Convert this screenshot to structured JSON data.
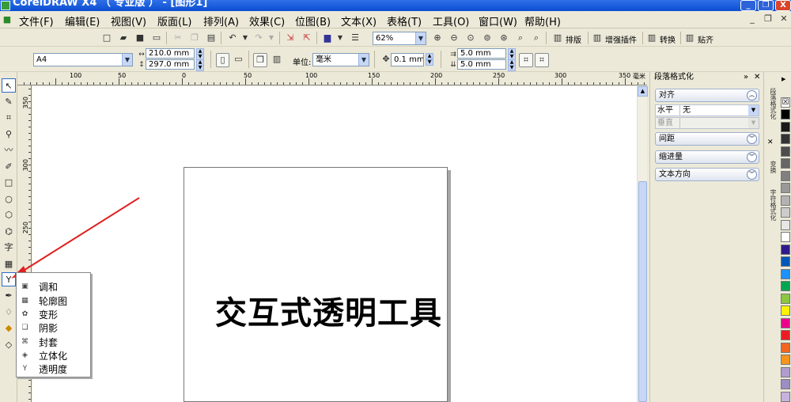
{
  "window": {
    "title": "CorelDRAW X4 （ 专业版 ） - [图形1]",
    "minimize": "_",
    "restore": "❐",
    "close": "X"
  },
  "menu": [
    {
      "key": "file",
      "label": "文件(F)"
    },
    {
      "key": "edit",
      "label": "编辑(E)"
    },
    {
      "key": "view",
      "label": "视图(V)"
    },
    {
      "key": "layout",
      "label": "版面(L)"
    },
    {
      "key": "arrange",
      "label": "排列(A)"
    },
    {
      "key": "effects",
      "label": "效果(C)"
    },
    {
      "key": "bitmaps",
      "label": "位图(B)"
    },
    {
      "key": "text",
      "label": "文本(X)"
    },
    {
      "key": "table",
      "label": "表格(T)"
    },
    {
      "key": "tools",
      "label": "工具(O)"
    },
    {
      "key": "window",
      "label": "窗口(W)"
    },
    {
      "key": "help",
      "label": "帮助(H)"
    }
  ],
  "toolbar": {
    "zoom_value": "62%",
    "snap_label": "排版",
    "plugin_label": "增强插件",
    "convert_label": "转换",
    "paste_label": "贴齐"
  },
  "property_bar": {
    "page_size": "A4",
    "width": "210.0 mm",
    "height": "297.0 mm",
    "units_label": "单位:",
    "units_value": "毫米",
    "nudge": "0.1 mm",
    "dup_x": "5.0 mm",
    "dup_y": "5.0 mm"
  },
  "ruler": {
    "h_labels": [
      "100",
      "50",
      "0",
      "50",
      "100",
      "150",
      "200",
      "250",
      "300",
      "350"
    ],
    "h_unit": "毫米",
    "v_labels": [
      "350",
      "300",
      "250"
    ]
  },
  "toolbox": {
    "text_tool_glyph": "字"
  },
  "canvas": {
    "headline": "交互式透明工具"
  },
  "flyout": [
    {
      "icon": "blend-icon",
      "glyph": "▣",
      "label": "调和"
    },
    {
      "icon": "contour-icon",
      "glyph": "▦",
      "label": "轮廓图"
    },
    {
      "icon": "distort-icon",
      "glyph": "✿",
      "label": "变形"
    },
    {
      "icon": "drop-shadow-icon",
      "glyph": "❑",
      "label": "阴影"
    },
    {
      "icon": "envelope-icon",
      "glyph": "⌘",
      "label": "封套"
    },
    {
      "icon": "extrude-icon",
      "glyph": "◈",
      "label": "立体化"
    },
    {
      "icon": "transparency-icon",
      "glyph": "Y",
      "label": "透明度"
    }
  ],
  "docker": {
    "title": "段落格式化",
    "align_label": "对齐",
    "horizontal_label": "水平",
    "horizontal_value": "无",
    "vertical_label": "垂直",
    "spacing_label": "间距",
    "indent_label": "缩进量",
    "text_direction_label": "文本方向"
  },
  "side_tabs": [
    {
      "key": "para-format",
      "label": "段落格式化"
    },
    {
      "key": "transform",
      "label": "变换"
    },
    {
      "key": "char-format",
      "label": "字符格式化"
    }
  ],
  "palette_colors": [
    "#000000",
    "#1a1a1a",
    "#333333",
    "#4d4d4d",
    "#666666",
    "#808080",
    "#999999",
    "#b3b3b3",
    "#cccccc",
    "#e6e6e6",
    "#ffffff",
    "#2e1a8c",
    "#0057b8",
    "#1e90ff",
    "#00a650",
    "#8dc63f",
    "#fff200",
    "#ec008c",
    "#ed1c24",
    "#f26522",
    "#f7941d",
    "#b09ccf",
    "#9b8ec4",
    "#c7b2de"
  ],
  "colors": {
    "titlebar": "#0a4ed1",
    "chrome": "#ece9d8",
    "annotation_arrow": "#e02020"
  }
}
